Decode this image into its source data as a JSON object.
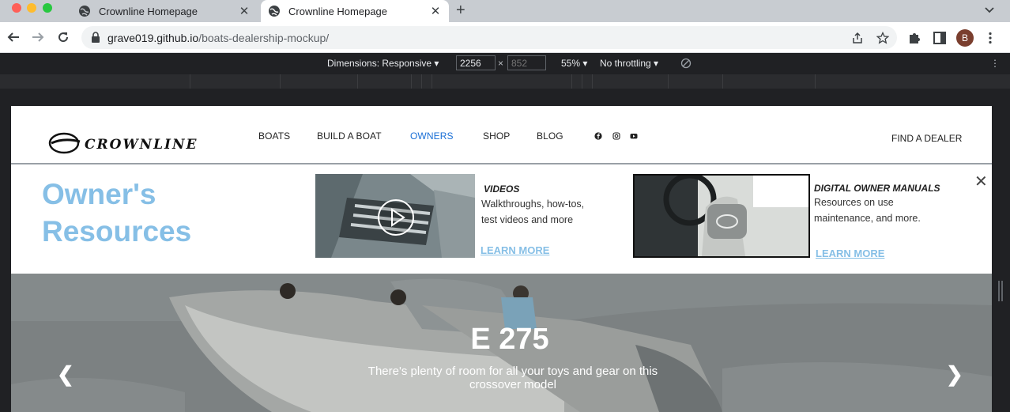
{
  "browser": {
    "tabs": [
      {
        "title": "Crownline Homepage"
      },
      {
        "title": "Crownline Homepage"
      }
    ],
    "url_domain": "grave019.github.io",
    "url_path": "/boats-dealership-mockup/",
    "profile_initial": "B"
  },
  "devtools": {
    "dimensions_label": "Dimensions: Responsive ▾",
    "width_value": "2256",
    "height_placeholder": "852",
    "times": "×",
    "zoom": "55% ▾",
    "throttling": "No throttling ▾"
  },
  "site": {
    "nav": {
      "boats": "BOATS",
      "build": "BUILD A BOAT",
      "owners": "OWNERS",
      "shop": "SHOP",
      "blog": "BLOG",
      "find_dealer": "FIND A DEALER"
    },
    "dropdown": {
      "title_line1": "Owner's",
      "title_line2": "Resources",
      "videos": {
        "heading": "VIDEOS",
        "desc_line1": "Walkthroughs, how-tos,",
        "desc_line2": "test videos and more",
        "link": "LEARN MORE"
      },
      "manuals": {
        "heading": "DIGITAL OWNER MANUALS",
        "desc_line1": "Resources on use",
        "desc_line2": "maintenance, and more.",
        "link": "LEARN MORE"
      },
      "close": "✕"
    },
    "hero": {
      "title": "E 275",
      "subtitle": "There's plenty of room for all your toys and gear on this crossover model",
      "prev": "❮",
      "next": "❯"
    }
  },
  "colors": {
    "accent_light_blue": "#86bfe6",
    "active_nav": "#1a6fd6"
  }
}
